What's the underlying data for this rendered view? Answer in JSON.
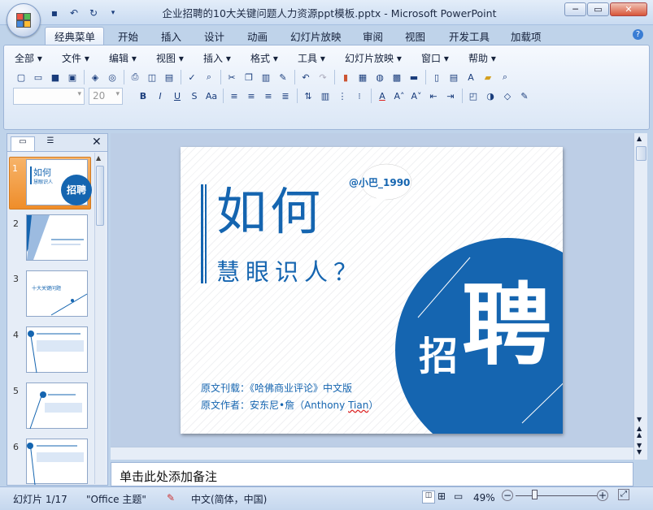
{
  "window": {
    "title": "企业招聘的10大关键问题人力资源ppt模板.pptx - Microsoft PowerPoint"
  },
  "ribbon_tabs": [
    {
      "label": "经典菜单",
      "active": true
    },
    {
      "label": "开始"
    },
    {
      "label": "插入"
    },
    {
      "label": "设计"
    },
    {
      "label": "动画"
    },
    {
      "label": "幻灯片放映"
    },
    {
      "label": "审阅"
    },
    {
      "label": "视图"
    },
    {
      "label": "开发工具"
    },
    {
      "label": "加载项"
    }
  ],
  "classic_menu": [
    "全部",
    "文件",
    "编辑",
    "视图",
    "插入",
    "格式",
    "工具",
    "幻灯片放映",
    "窗口",
    "帮助"
  ],
  "font_size_value": "20",
  "slide_numbers": [
    "1",
    "2",
    "3",
    "4",
    "5",
    "6"
  ],
  "slide": {
    "bubble": "@小巴_1990",
    "title_line1": "如何",
    "title_line2": "慧眼识人？",
    "char_small": "招",
    "char_big": "聘",
    "source1": "原文刊载：《哈佛商业评论》中文版",
    "source2_prefix": "原文作者：安东尼•詹（Anthony ",
    "source2_tian": "Tian",
    "source2_suffix": "）"
  },
  "thumb1": {
    "title": "如何",
    "sub": "慧眼识人",
    "char": "招聘"
  },
  "thumb3": {
    "title": "十大关键问题"
  },
  "notes_placeholder": "单击此处添加备注",
  "status": {
    "slide_info": "幻灯片 1/17",
    "theme": "\"Office 主题\"",
    "language": "中文(简体，中国)",
    "zoom": "49%"
  },
  "colors": {
    "accent": "#1565b0",
    "orange": "#ef8d2a"
  }
}
